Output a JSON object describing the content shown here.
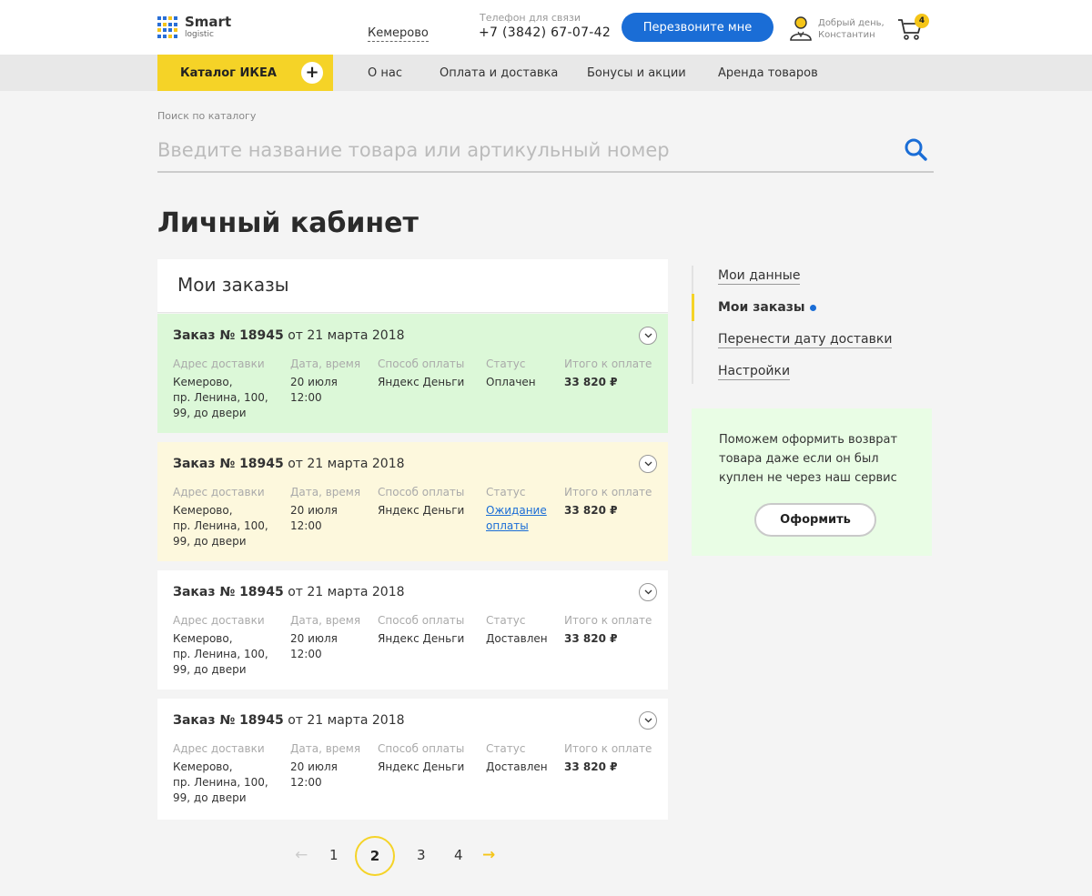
{
  "header": {
    "logo_title": "Smart",
    "logo_sub": "logistic",
    "city": "Кемерово",
    "phone_label": "Телефон для связи",
    "phone": "+7 (3842) 67-07-42",
    "callback_label": "Перезвоните мне",
    "greeting_line1": "Добрый день,",
    "greeting_line2": "Константин",
    "cart_count": "4"
  },
  "nav": {
    "catalog_label": "Каталог ИКЕА",
    "catalog_plus": "+",
    "items": [
      "О нас",
      "Оплата и доставка",
      "Бонусы и акции",
      "Аренда товаров"
    ]
  },
  "search": {
    "label": "Поиск по каталогу",
    "placeholder": "Введите название товара или артикульный номер"
  },
  "page_title": "Личный кабинет",
  "orders": {
    "title": "Мои заказы",
    "col_labels": {
      "address": "Адрес доставки",
      "datetime": "Дата, время",
      "payment": "Способ оплаты",
      "status": "Статус",
      "total": "Итого к оплате"
    },
    "items": [
      {
        "number": "Заказ № 18945",
        "date": " от 21 марта 2018",
        "address_lines": [
          "Кемерово,",
          "пр. Ленина, 100,",
          "99, до двери"
        ],
        "datetime_lines": [
          "20 июля",
          "12:00"
        ],
        "payment": "Яндекс Деньги",
        "status_lines": [
          "Оплачен"
        ],
        "total": "33 820 ₽"
      },
      {
        "number": "Заказ № 18945",
        "date": " от 21 марта 2018",
        "address_lines": [
          "Кемерово,",
          "пр. Ленина, 100,",
          "99, до двери"
        ],
        "datetime_lines": [
          "20 июля",
          "12:00"
        ],
        "payment": "Яндекс Деньги",
        "status_lines": [
          "Ожидание",
          "оплаты"
        ],
        "total": "33 820 ₽"
      },
      {
        "number": "Заказ № 18945",
        "date": " от 21 марта 2018",
        "address_lines": [
          "Кемерово,",
          "пр. Ленина, 100,",
          "99, до двери"
        ],
        "datetime_lines": [
          "20 июля",
          "12:00"
        ],
        "payment": "Яндекс Деньги",
        "status_lines": [
          "Доставлен"
        ],
        "total": "33 820 ₽"
      },
      {
        "number": "Заказ № 18945",
        "date": " от 21 марта 2018",
        "address_lines": [
          "Кемерово,",
          "пр. Ленина, 100,",
          "99, до двери"
        ],
        "datetime_lines": [
          "20 июля",
          "12:00"
        ],
        "payment": "Яндекс Деньги",
        "status_lines": [
          "Доставлен"
        ],
        "total": "33 820 ₽"
      }
    ]
  },
  "pagination": {
    "prev": "←",
    "pages": [
      "1",
      "2",
      "3",
      "4"
    ],
    "current": "2",
    "next": "→"
  },
  "sidebar": {
    "items": [
      "Мои данные",
      "Мои заказы",
      "Перенести дату доставки",
      "Настройки"
    ],
    "active": "Мои заказы"
  },
  "return_box": {
    "text": "Поможем оформить возврат товара даже если он был куплен не через наш сервис",
    "button": "Оформить"
  },
  "colors": {
    "accent_blue": "#1a6dd6",
    "accent_yellow": "#f5d327",
    "paid_bg": "#dcf8d8",
    "waiting_bg": "#fdf8dd"
  }
}
